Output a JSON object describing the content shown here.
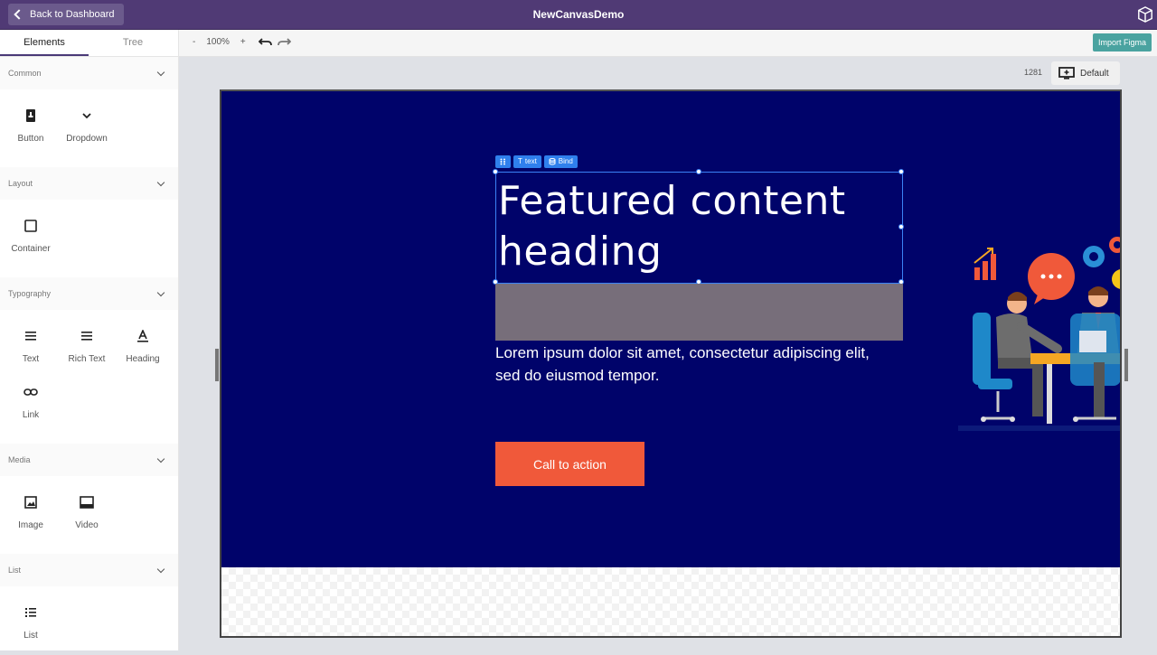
{
  "topbar": {
    "back_label": "Back to Dashboard",
    "title": "NewCanvasDemo"
  },
  "left_panel": {
    "tabs": [
      {
        "label": "Elements",
        "active": true
      },
      {
        "label": "Tree",
        "active": false
      }
    ],
    "sections": {
      "common": {
        "title": "Common",
        "items": [
          "Button",
          "Dropdown"
        ]
      },
      "layout": {
        "title": "Layout",
        "items": [
          "Container"
        ]
      },
      "typography": {
        "title": "Typography",
        "items": [
          "Text",
          "Rich Text",
          "Heading",
          "Link"
        ]
      },
      "media": {
        "title": "Media",
        "items": [
          "Image",
          "Video"
        ]
      },
      "list": {
        "title": "List",
        "items": [
          "List"
        ]
      }
    }
  },
  "toolbar": {
    "zoom_out": "-",
    "zoom_level": "100%",
    "zoom_in": "+",
    "import_label": "Import Figma"
  },
  "canvas": {
    "width_value": "1281",
    "device_label": "Default",
    "selection": {
      "text_chip": "text",
      "bind_chip": "Bind"
    },
    "hero": {
      "heading_line1": "Featured content",
      "heading_line2": "heading",
      "paragraph": "Lorem ipsum dolor sit amet, consectetur adipiscing elit, sed do eiusmod tempor.",
      "cta_label": "Call to action"
    }
  },
  "colors": {
    "topbar": "#503a75",
    "hero_bg": "#00036a",
    "cta_bg": "#f0593a",
    "selection": "#2f80ed",
    "import_btn": "#4aa3a0"
  }
}
